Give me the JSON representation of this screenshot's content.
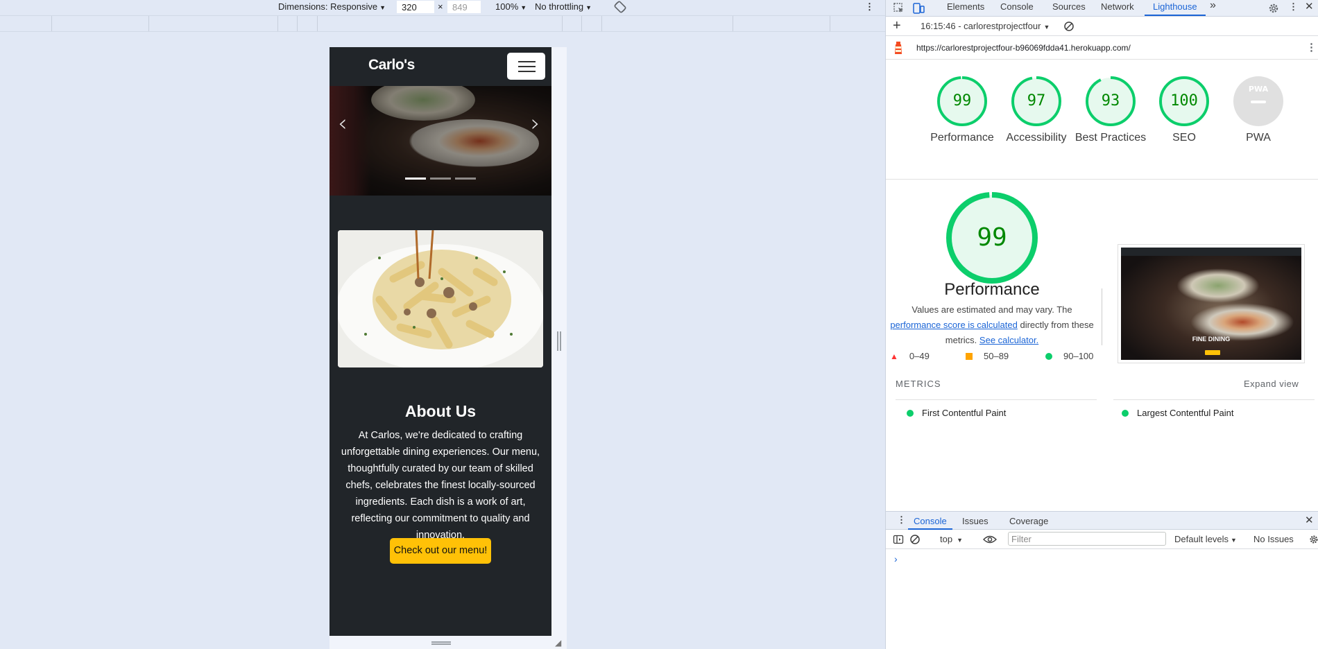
{
  "device_toolbar": {
    "dimensions_label": "Dimensions: Responsive",
    "width_value": "320",
    "times": "×",
    "height_placeholder": "849",
    "zoom": "100%",
    "throttling": "No throttling"
  },
  "viewport": {
    "brand": "Carlo's",
    "carousel": {
      "prev": "‹",
      "next": "›",
      "slide_count": 3,
      "active_index": 0
    },
    "about": {
      "title": "About Us",
      "text": "At Carlos, we're dedicated to crafting unforgettable dining experiences. Our menu, thoughtfully curated by our team of skilled chefs, celebrates the finest locally-sourced ingredients. Each dish is a work of art, reflecting our commitment to quality and innovation.",
      "button": "Check out our menu!"
    },
    "colors": {
      "navbar": "#212529",
      "accent": "#ffc107"
    }
  },
  "devtools": {
    "tabs": [
      "Elements",
      "Console",
      "Sources",
      "Network",
      "Lighthouse"
    ],
    "active_tab": "Lighthouse",
    "more_tabs": "»",
    "report_selector": "16:15:46 - carlorestprojectfour",
    "url": "https://carlorestprojectfour-b96069fdda41.herokuapp.com/",
    "gauges": [
      {
        "score": "99",
        "label": "Performance"
      },
      {
        "score": "97",
        "label": "Accessibility"
      },
      {
        "score": "93",
        "label": "Best Practices"
      },
      {
        "score": "100",
        "label": "SEO"
      },
      {
        "score": "PWA",
        "label": "PWA"
      }
    ],
    "performance": {
      "score": "99",
      "title": "Performance",
      "desc_part1": "Values are estimated and may vary. The",
      "desc_link1": "performance score is calculated",
      "desc_part2": "directly from these metrics.",
      "desc_link2": "See calculator.",
      "legend": [
        "0–49",
        "50–89",
        "90–100"
      ]
    },
    "screenshot": {
      "title": "FINE DINING"
    },
    "metrics": {
      "heading": "METRICS",
      "expand": "Expand view",
      "items": [
        "First Contentful Paint",
        "Largest Contentful Paint"
      ]
    },
    "drawer": {
      "tabs": [
        "Console",
        "Issues",
        "Coverage"
      ],
      "active_tab": "Console",
      "context": "top",
      "filter_placeholder": "Filter",
      "levels": "Default levels",
      "issues": "No Issues",
      "prompt": "›"
    },
    "colors": {
      "accent": "#1a64d6",
      "pass": "#0cce6b",
      "pass_text": "#008800",
      "average": "#ffa400",
      "fail": "#ff3333"
    }
  }
}
